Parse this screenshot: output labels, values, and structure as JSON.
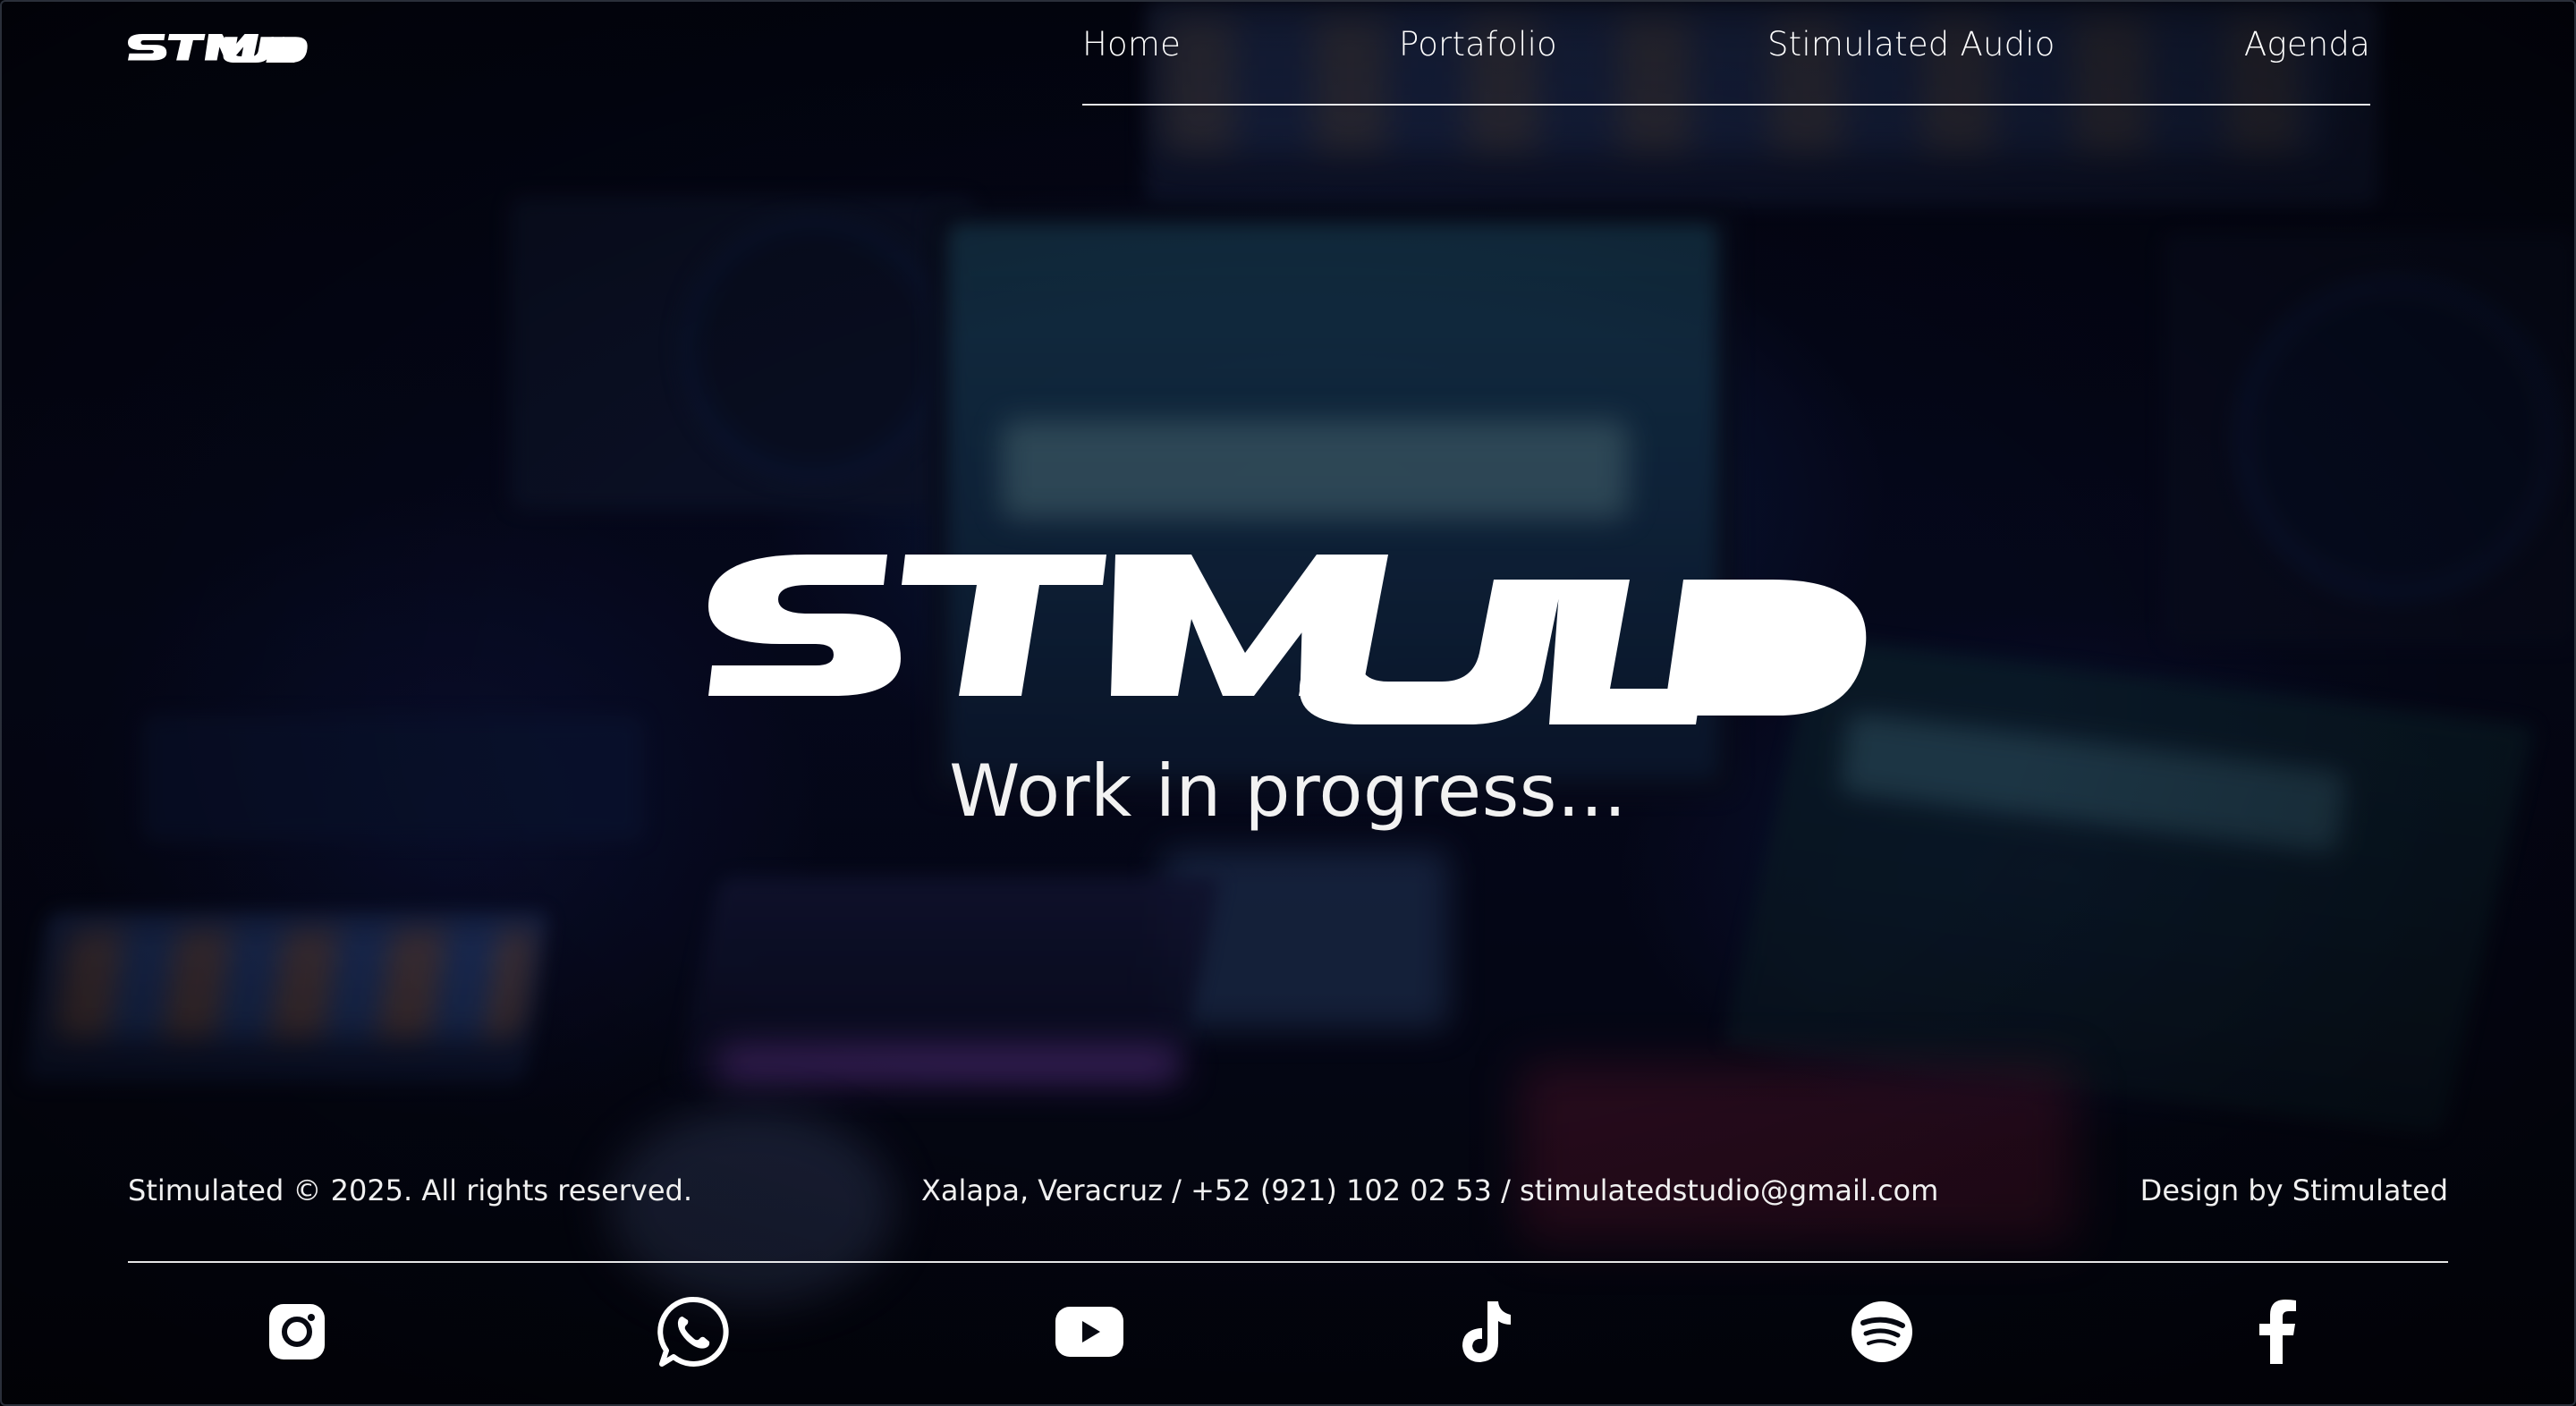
{
  "brand": {
    "logo_text": "STMULD"
  },
  "nav": {
    "items": [
      {
        "label": "Home"
      },
      {
        "label": "Portafolio"
      },
      {
        "label": "Stimulated Audio"
      },
      {
        "label": "Agenda"
      }
    ]
  },
  "hero": {
    "logo_text": "STMULD",
    "tagline": "Work in progress..."
  },
  "footer": {
    "copyright": "Stimulated © 2025. All rights reserved.",
    "contact": "Xalapa, Veracruz / +52 (921) 102 02 53 / stimulatedstudio@gmail.com",
    "credit": "Design by Stimulated",
    "social": [
      "instagram-icon",
      "whatsapp-icon",
      "youtube-icon",
      "tiktok-icon",
      "spotify-icon",
      "facebook-icon"
    ]
  },
  "colors": {
    "text": "#ffffff",
    "background": "#05060f",
    "accent_blue": "#1d4a63"
  }
}
